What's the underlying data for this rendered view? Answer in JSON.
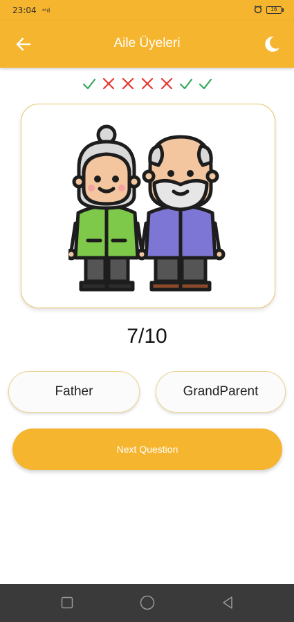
{
  "status_bar": {
    "time": "23:04",
    "signal": "⁴⁶ıl",
    "battery": "16"
  },
  "app_bar": {
    "title": "Aile Üyeleri",
    "back_icon": "arrow-left-icon",
    "theme_icon": "moon-icon"
  },
  "progress": {
    "marks": [
      "correct",
      "wrong",
      "wrong",
      "wrong",
      "wrong",
      "correct",
      "correct"
    ]
  },
  "question": {
    "image_icon": "grandparents-illustration",
    "score": "7/10"
  },
  "answers": [
    {
      "label": "Father"
    },
    {
      "label": "GrandParent"
    }
  ],
  "next_button": {
    "label": "Next Question"
  },
  "colors": {
    "accent": "#f5b52e",
    "correct": "#36a85c",
    "wrong": "#e53935",
    "card_border": "#e9c56a"
  }
}
